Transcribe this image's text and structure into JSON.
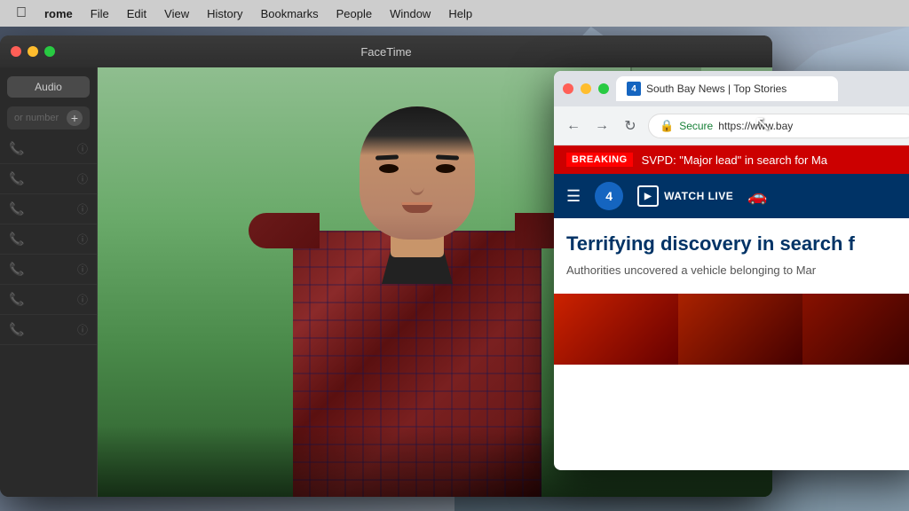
{
  "menubar": {
    "apple": "⌘",
    "items": [
      {
        "id": "chrome",
        "label": "rome"
      },
      {
        "id": "file",
        "label": "File"
      },
      {
        "id": "edit",
        "label": "Edit"
      },
      {
        "id": "view",
        "label": "View"
      },
      {
        "id": "history",
        "label": "History"
      },
      {
        "id": "bookmarks",
        "label": "Bookmarks"
      },
      {
        "id": "people",
        "label": "People"
      },
      {
        "id": "window",
        "label": "Window"
      },
      {
        "id": "help",
        "label": "Help"
      }
    ]
  },
  "facetime": {
    "title": "FaceTime",
    "audio_btn": "Audio",
    "search_placeholder": "or number",
    "contacts": [
      {
        "phone": "📞",
        "info": "ⓘ"
      },
      {
        "phone": "📞",
        "info": "ⓘ"
      },
      {
        "phone": "📞",
        "info": "ⓘ"
      },
      {
        "phone": "📞",
        "info": "ⓘ"
      },
      {
        "phone": "📞",
        "info": "ⓘ"
      },
      {
        "phone": "📞",
        "info": "ⓘ"
      },
      {
        "phone": "📞",
        "info": "ⓘ"
      }
    ]
  },
  "chrome": {
    "tab_title": "South Bay News | Top Stories",
    "favicon_text": "4",
    "nav": {
      "back": "←",
      "forward": "→",
      "refresh": "↻"
    },
    "address": {
      "secure_label": "Secure",
      "url_prefix": "https://",
      "url_domain": "www.bay"
    },
    "breaking": {
      "label": "BREAKING",
      "text": "SVPD: \"Major lead\" in search for Ma"
    },
    "channel_nav": {
      "watch_live": "WATCH LIVE"
    },
    "article": {
      "headline": "Terrifying discovery in search f",
      "subtitle": "Authorities uncovered a vehicle belonging to Mar"
    }
  },
  "cursor": "↖"
}
